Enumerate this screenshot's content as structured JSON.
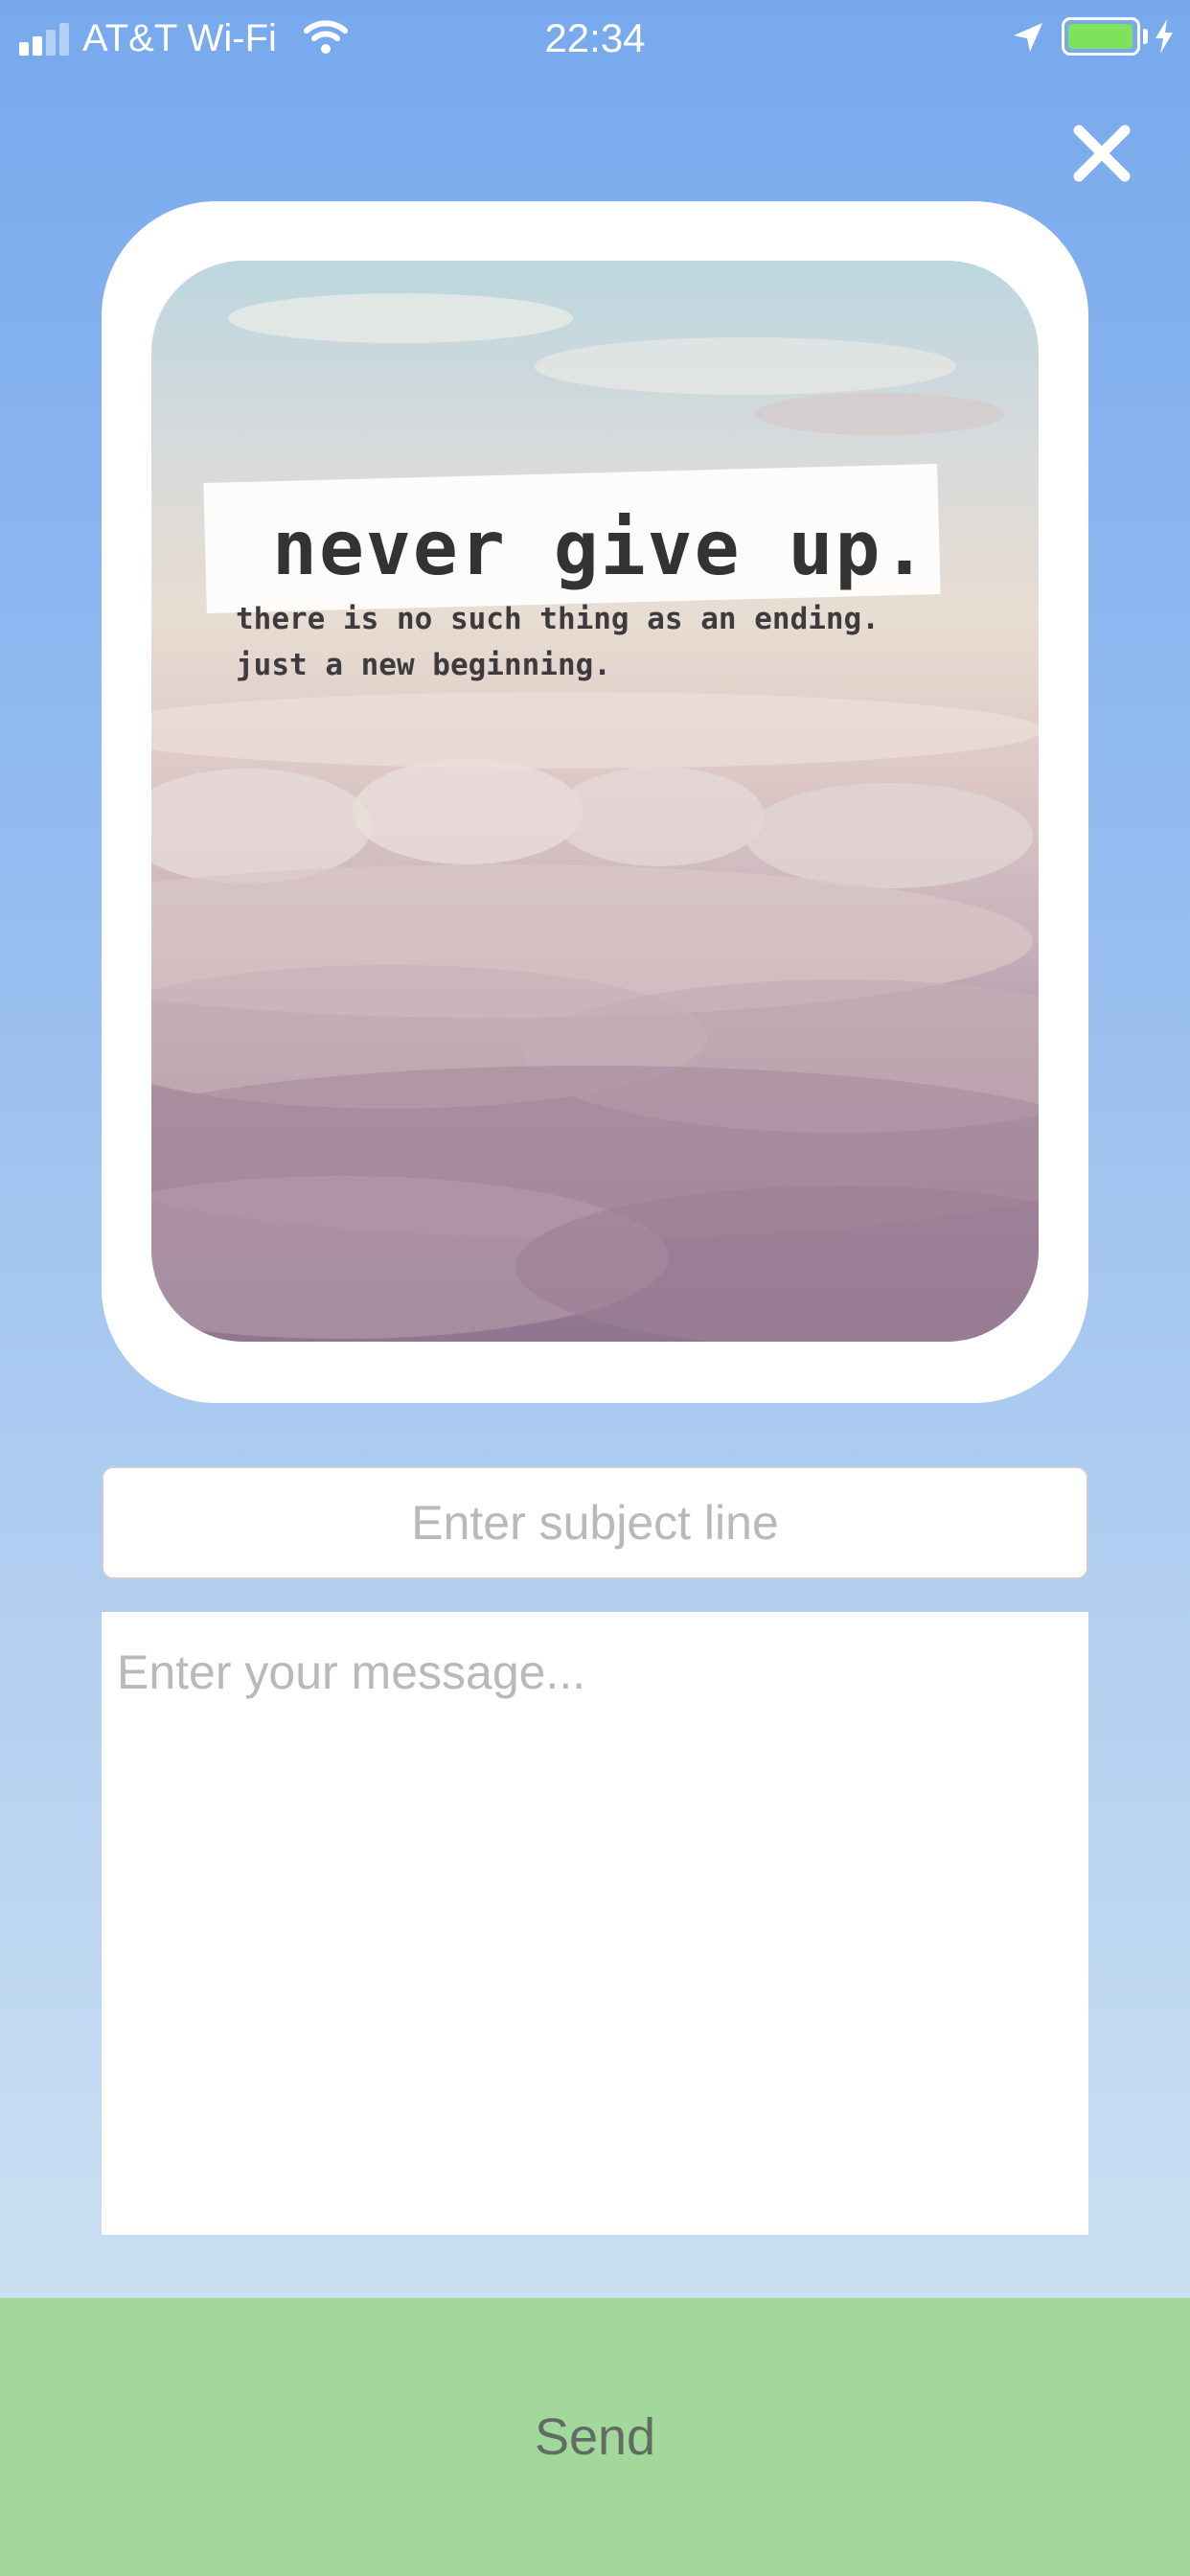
{
  "status_bar": {
    "carrier": "AT&T Wi-Fi",
    "time": "22:34",
    "battery_color": "#7ee35b"
  },
  "icons": [
    "signal-icon",
    "wifi-icon",
    "location-arrow-icon",
    "battery-icon",
    "charging-bolt-icon",
    "close-icon"
  ],
  "card": {
    "title": "never give up.",
    "line1": "there is no such thing as an ending.",
    "line2": "just a new beginning."
  },
  "form": {
    "subject_placeholder": "Enter subject line",
    "subject_value": "",
    "message_placeholder": "Enter your message...",
    "message_value": ""
  },
  "send_label": "Send",
  "colors": {
    "background_top": "#78a9ee",
    "background_bottom": "#d4e6f3",
    "send_button": "#a2d89b"
  }
}
